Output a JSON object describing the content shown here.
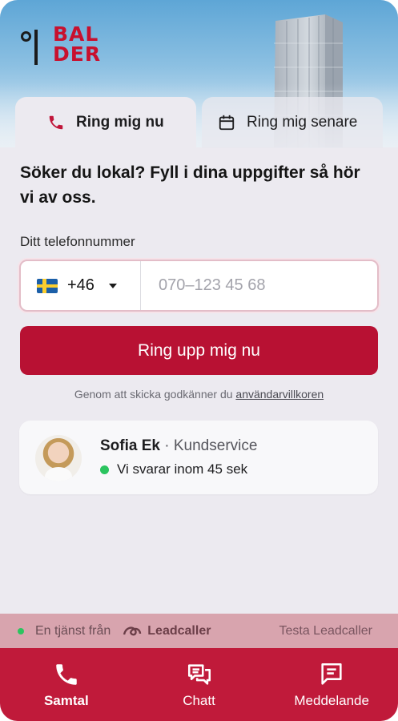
{
  "brand": {
    "logo_text_line1": "BAL",
    "logo_text_line2": "DER",
    "accent": "#c8102e"
  },
  "tabs": [
    {
      "label": "Ring mig nu",
      "icon": "phone-icon",
      "active": true
    },
    {
      "label": "Ring mig senare",
      "icon": "calendar-icon",
      "active": false
    }
  ],
  "form": {
    "headline": "Söker du lokal? Fyll i dina uppgifter så hör vi av oss.",
    "phone_label": "Ditt telefonnummer",
    "country_code": "+46",
    "country_flag": "sweden-flag",
    "phone_placeholder": "070–123 45 68",
    "submit_label": "Ring upp mig nu",
    "terms_prefix": "Genom att skicka godkänner du ",
    "terms_link": "användarvillkoren"
  },
  "agent": {
    "name": "Sofia Ek",
    "separator": " · ",
    "role": "Kundservice",
    "status": "Vi svarar inom 45 sek"
  },
  "powered_by": {
    "text": "En tjänst från",
    "brand": "Leadcaller",
    "try_link": "Testa Leadcaller"
  },
  "bottom_nav": [
    {
      "label": "Samtal",
      "icon": "phone-icon",
      "active": true
    },
    {
      "label": "Chatt",
      "icon": "chat-bubbles-icon",
      "active": false
    },
    {
      "label": "Meddelande",
      "icon": "message-icon",
      "active": false
    }
  ]
}
